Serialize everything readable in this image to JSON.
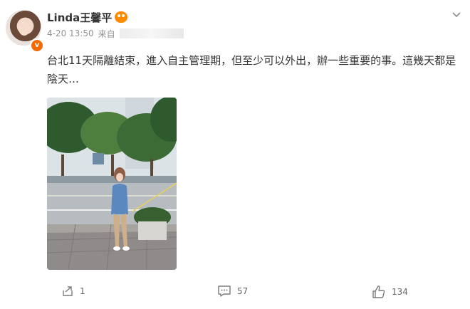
{
  "author": {
    "name": "Linda王馨平",
    "avatar_icon": "user-avatar",
    "badge_icon": "verified-badge-icon",
    "member_icon": "member-crown-icon"
  },
  "meta": {
    "time": "4-20 13:50",
    "source_label": "来自"
  },
  "post": {
    "text": "台北11天隔離結束，進入自主管理期，但至少可以外出，辦一些重要的事。這幾天都是陰天…",
    "image_alt": "photo"
  },
  "actions": {
    "share_count": "1",
    "comment_count": "57",
    "like_count": "134"
  },
  "colors": {
    "accent": "#ff8200",
    "text": "#333333",
    "meta": "#939393"
  }
}
